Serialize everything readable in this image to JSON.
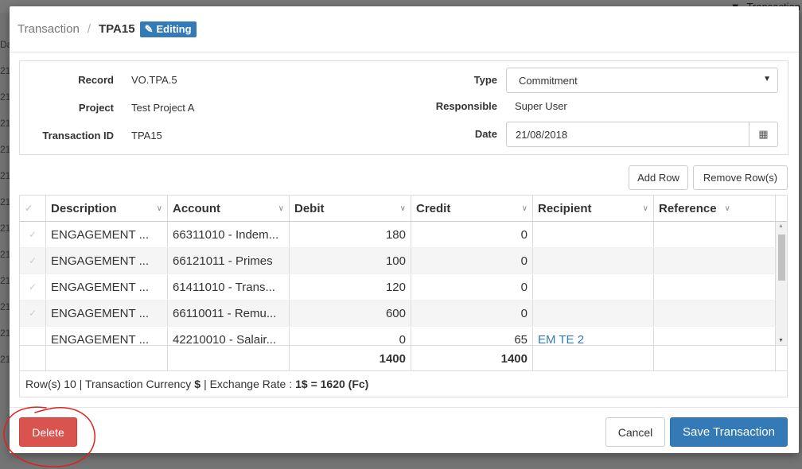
{
  "background": {
    "topbar_right_label": "Transaction",
    "left_chars": [
      "Da",
      "21",
      "21",
      "21",
      "21",
      "21",
      "21",
      "21",
      "21",
      "21",
      "21",
      "21",
      "21"
    ],
    "right_char": "e"
  },
  "modal": {
    "breadcrumb": {
      "parent": "Transaction",
      "separator": "/",
      "current": "TPA15"
    },
    "badge": "Editing",
    "form": {
      "record": {
        "label": "Record",
        "value": "VO.TPA.5"
      },
      "project": {
        "label": "Project",
        "value": "Test Project A"
      },
      "transaction_id": {
        "label": "Transaction ID",
        "value": "TPA15"
      },
      "type": {
        "label": "Type",
        "value": "Commitment"
      },
      "responsible": {
        "label": "Responsible",
        "value": "Super User"
      },
      "date": {
        "label": "Date",
        "value": "21/08/2018"
      }
    },
    "buttons": {
      "add_row": "Add Row",
      "remove_rows": "Remove Row(s)"
    },
    "grid": {
      "columns": [
        "Description",
        "Account",
        "Debit",
        "Credit",
        "Recipient",
        "Reference"
      ],
      "rows": [
        {
          "description": "ENGAGEMENT ...",
          "account": "66311010 - Indem...",
          "debit": "180",
          "credit": "0",
          "recipient": "",
          "reference": ""
        },
        {
          "description": "ENGAGEMENT ...",
          "account": "66121011 - Primes",
          "debit": "100",
          "credit": "0",
          "recipient": "",
          "reference": ""
        },
        {
          "description": "ENGAGEMENT ...",
          "account": "61411010 - Trans...",
          "debit": "120",
          "credit": "0",
          "recipient": "",
          "reference": ""
        },
        {
          "description": "ENGAGEMENT ...",
          "account": "66110011 - Remu...",
          "debit": "600",
          "credit": "0",
          "recipient": "",
          "reference": ""
        },
        {
          "description": "ENGAGEMENT ...",
          "account": "42210010 - Salair...",
          "debit": "0",
          "credit": "65",
          "recipient": "EM TE 2",
          "reference": ""
        }
      ],
      "totals": {
        "debit": "1400",
        "credit": "1400"
      }
    },
    "status": {
      "rows_text": "Row(s) 10 | Transaction Currency",
      "currency": "$",
      "rate_label": "| Exchange Rate :",
      "rate_value": "1$ = 1620 (Fc)"
    },
    "footer": {
      "delete": "Delete",
      "cancel": "Cancel",
      "save": "Save Transaction"
    }
  },
  "colors": {
    "primary": "#337ab7",
    "danger": "#d9534f",
    "annotation": "#e0201c"
  }
}
